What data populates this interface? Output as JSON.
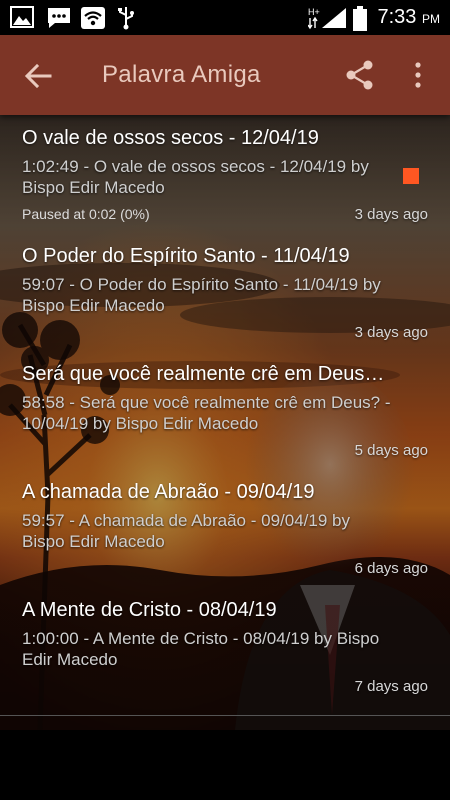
{
  "status_bar": {
    "time": "7:33",
    "ampm": "PM",
    "icons": [
      "image-icon",
      "chat-icon",
      "wifi-icon",
      "usb-icon",
      "signal-icon",
      "battery-icon"
    ]
  },
  "app_bar": {
    "title": "Palavra Amiga",
    "color": "#7d3526"
  },
  "episodes": [
    {
      "title": "O vale de ossos secos - 12/04/19",
      "description": "1:02:49 - O vale de ossos secos - 12/04/19 by Bispo Edir Macedo",
      "status": "Paused at 0:02 (0%)",
      "date": "3 days ago",
      "playing": true
    },
    {
      "title": "O Poder do Espírito Santo - 11/04/19",
      "description": "59:07 - O Poder do Espírito Santo - 11/04/19 by Bispo Edir Macedo",
      "status": "",
      "date": "3 days ago",
      "playing": false
    },
    {
      "title": "Será que você realmente crê em Deus…",
      "description": "58:58 - Será que você realmente crê em Deus? - 10/04/19 by Bispo Edir Macedo",
      "status": "",
      "date": "5 days ago",
      "playing": false
    },
    {
      "title": "A chamada de Abraão - 09/04/19",
      "description": "59:57 - A chamada de Abraão - 09/04/19 by Bispo Edir Macedo",
      "status": "",
      "date": "6 days ago",
      "playing": false
    },
    {
      "title": "A Mente de Cristo - 08/04/19",
      "description": "1:00:00 - A Mente de Cristo - 08/04/19 by Bispo Edir Macedo",
      "status": "",
      "date": "7 days ago",
      "playing": false
    }
  ],
  "accent_color": "#ff5722"
}
